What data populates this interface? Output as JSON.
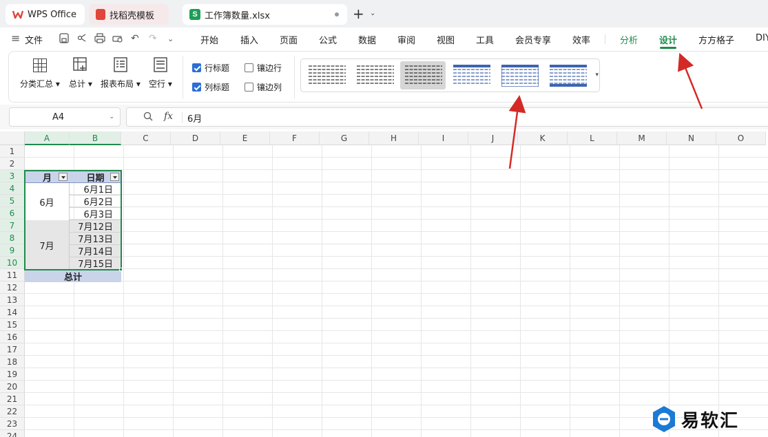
{
  "tabs": [
    {
      "label": "WPS Office"
    },
    {
      "label": "找稻壳模板"
    },
    {
      "label": "工作簿数量.xlsx"
    }
  ],
  "menu": {
    "file": "文件",
    "items": [
      "开始",
      "插入",
      "页面",
      "公式",
      "数据",
      "审阅",
      "视图",
      "工具",
      "会员专享",
      "效率"
    ],
    "fenxi": "分析",
    "sheji": "设计",
    "extra": [
      "方方格子",
      "DIY"
    ]
  },
  "ribbon": {
    "buttons": [
      "分类汇总",
      "总计",
      "报表布局",
      "空行"
    ],
    "checks": [
      {
        "label": "行标题",
        "checked": true
      },
      {
        "label": "镶边行",
        "checked": false
      },
      {
        "label": "列标题",
        "checked": true
      },
      {
        "label": "镶边列",
        "checked": false
      }
    ],
    "styles_count": 6,
    "selected_style": 3
  },
  "formula": {
    "name_box": "A4",
    "fx": "fx",
    "content": "6月"
  },
  "sheet": {
    "columns": [
      "A",
      "B",
      "C",
      "D",
      "E",
      "F",
      "G",
      "H",
      "I",
      "J",
      "K",
      "L",
      "M",
      "N",
      "O"
    ],
    "rows": [
      "1",
      "2",
      "3",
      "4",
      "5",
      "6",
      "7",
      "8",
      "9",
      "10",
      "11",
      "12",
      "13",
      "14",
      "15",
      "16",
      "17",
      "18",
      "19",
      "20",
      "21",
      "22",
      "23",
      "24"
    ],
    "active_columns": [
      "A",
      "B"
    ],
    "active_rows": [
      "3",
      "4",
      "5",
      "6",
      "7",
      "8",
      "9",
      "10"
    ]
  },
  "pivot": {
    "header_month": "月",
    "header_date": "日期",
    "groups": [
      {
        "month": "6月",
        "dates": [
          "6月1日",
          "6月2日",
          "6月3日"
        ]
      },
      {
        "month": "7月",
        "dates": [
          "7月12日",
          "7月13日",
          "7月14日",
          "7月15日"
        ]
      }
    ],
    "total": "总计"
  },
  "watermark": {
    "text": "易软汇"
  },
  "colors": {
    "accent": "#1f8a4c",
    "pivot_header": "#c9d4ea",
    "arrow": "#d42a26"
  }
}
